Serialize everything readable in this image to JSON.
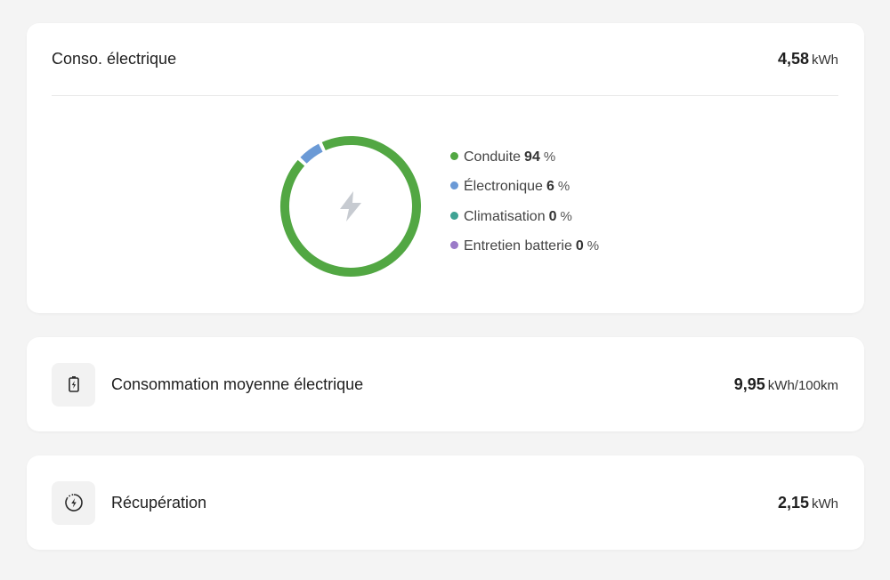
{
  "main_card": {
    "title": "Conso. électrique",
    "value": "4,58",
    "unit": "kWh",
    "center_icon": "lightning-bolt-icon"
  },
  "chart_data": {
    "type": "pie",
    "categories": [
      "Conduite",
      "Électronique",
      "Climatisation",
      "Entretien batterie"
    ],
    "values": [
      94,
      6,
      0,
      0
    ],
    "colors": [
      "#52a743",
      "#6b9ad6",
      "#3fa394",
      "#9b7bc8"
    ],
    "unit": "%",
    "legend_position": "right",
    "style": "donut"
  },
  "legend": [
    {
      "label": "Conduite",
      "value": "94",
      "sign": "%",
      "color": "#52a743"
    },
    {
      "label": "Électronique",
      "value": "6",
      "sign": "%",
      "color": "#6b9ad6"
    },
    {
      "label": "Climatisation",
      "value": "0",
      "sign": "%",
      "color": "#3fa394"
    },
    {
      "label": "Entretien batterie",
      "value": "0",
      "sign": "%",
      "color": "#9b7bc8"
    }
  ],
  "avg_card": {
    "title": "Consommation moyenne électrique",
    "value": "9,95",
    "unit": "kWh/100km",
    "icon": "battery-charge-icon"
  },
  "recup_card": {
    "title": "Récupération",
    "value": "2,15",
    "unit": "kWh",
    "icon": "energy-recovery-icon"
  }
}
